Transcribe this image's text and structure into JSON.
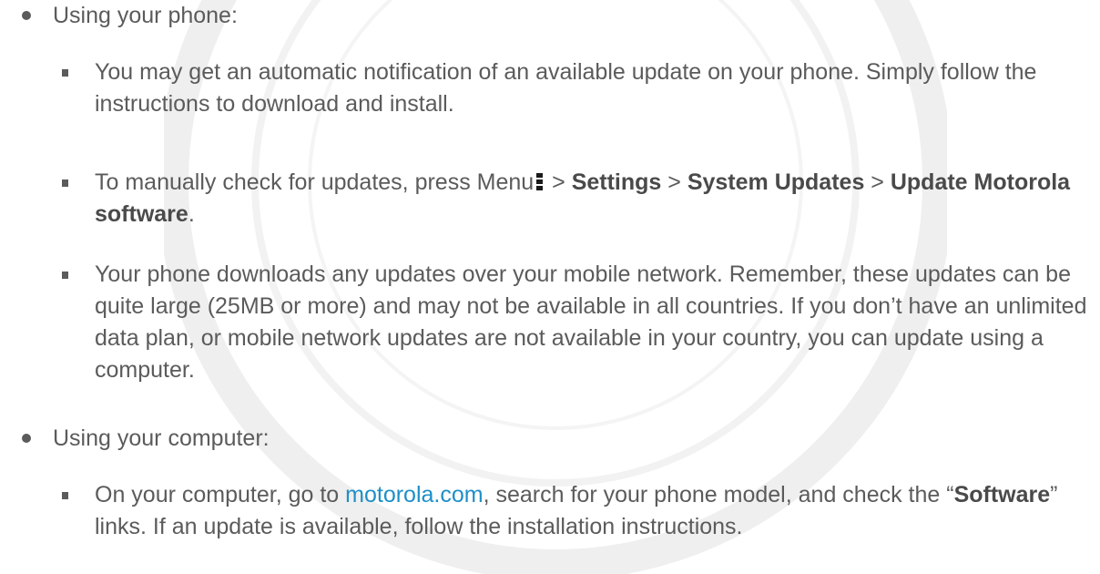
{
  "section_phone": {
    "heading": "Using your phone:",
    "items": [
      {
        "text": "You may get an automatic notification of an available update on your phone. Simply follow the instructions to download and install."
      },
      {
        "pre": "To manually check for updates, press Menu",
        "sep1": " > ",
        "settings": "Settings",
        "sep2": " > ",
        "system_updates": "System Updates",
        "sep3": " > ",
        "update_motorola": "Update Motorola software",
        "end": "."
      },
      {
        "text": "Your phone downloads any updates over your mobile network. Remember, these updates can be quite large (25MB or more) and may not be available in all countries. If you don’t have an unlimited data plan, or mobile network updates are not available in your country, you can update using a computer."
      }
    ]
  },
  "section_computer": {
    "heading": "Using your computer:",
    "items": [
      {
        "pre": "On your computer, go to ",
        "link": "motorola.com",
        "mid": ", search for your phone model, and check the ",
        "open_quote": "“",
        "software": "Software",
        "close_quote": "”",
        "post": " links. If an update is available, follow the installation instructions."
      }
    ]
  },
  "icons": {
    "menu": "menu-icon",
    "watermark": "seal-watermark"
  },
  "colors": {
    "text": "#5b5b5b",
    "link": "#1e8fc9"
  }
}
